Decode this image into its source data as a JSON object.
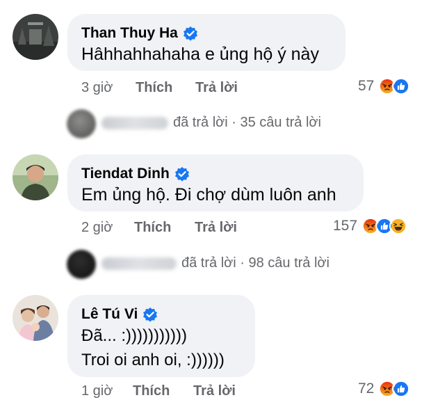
{
  "comments": [
    {
      "author": "Than Thuy Ha",
      "lines": [
        "Hâhhahhahaha e ủng hộ ý này"
      ],
      "time": "3 giờ",
      "like_label": "Thích",
      "reply_label": "Trả lời",
      "reaction_count": "57",
      "reactions": [
        "angry-icon",
        "like-icon"
      ]
    },
    {
      "author": "Tiendat Dinh",
      "lines": [
        "Em ủng hộ. Đi chợ dùm luôn anh"
      ],
      "time": "2 giờ",
      "like_label": "Thích",
      "reply_label": "Trả lời",
      "reaction_count": "157",
      "reactions": [
        "angry-icon",
        "like-icon",
        "haha-icon"
      ]
    },
    {
      "author": "Lê Tú Vi",
      "lines": [
        "Đã...  :)))))))))))",
        "Troi oi anh oi, :))))))"
      ],
      "time": "1 giờ",
      "like_label": "Thích",
      "reply_label": "Trả lời",
      "reaction_count": "72",
      "reactions": [
        "angry-icon",
        "like-icon"
      ]
    }
  ],
  "replies": [
    {
      "text": "đã trả lời · 35 câu trả lời"
    },
    {
      "text": "đã trả lời · 98 câu trả lời"
    }
  ],
  "colors": {
    "bubble": "#f0f2f5",
    "verified": "#1877f2",
    "like": "#1877f2",
    "angry": "#e9710f",
    "haha": "#f7b125",
    "secondary_text": "#65676b"
  }
}
